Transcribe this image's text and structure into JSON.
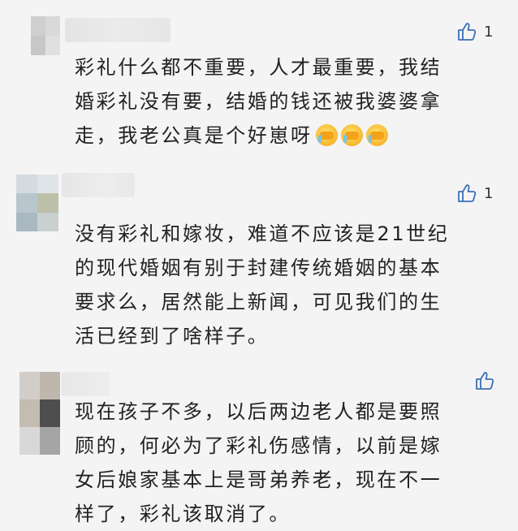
{
  "comments": [
    {
      "like_count": "1",
      "text": "彩礼什么都不重要，人才最重要，我结\n婚彩礼没有要，结婚的钱还被我婆婆拿\n走，我老公真是个好崽呀",
      "emojis": [
        "face-palm-emoji",
        "face-palm-emoji",
        "face-palm-emoji"
      ]
    },
    {
      "like_count": "1",
      "text": "没有彩礼和嫁妆，难道不应该是21世纪\n的现代婚姻有别于封建传统婚姻的基本\n要求么，居然能上新闻，可见我们的生\n活已经到了啥样子。"
    },
    {
      "like_count": "",
      "text": "现在孩子不多，以后两边老人都是要照\n顾的，何必为了彩礼伤感情，以前是嫁\n女后娘家基本上是哥弟养老，现在不一\n样了，彩礼该取消了。"
    }
  ],
  "icons": {
    "like": "thumbs-up-icon"
  },
  "colors": {
    "background": "#f4f4f4",
    "text": "#222222",
    "icon": "#3b6fb6"
  }
}
